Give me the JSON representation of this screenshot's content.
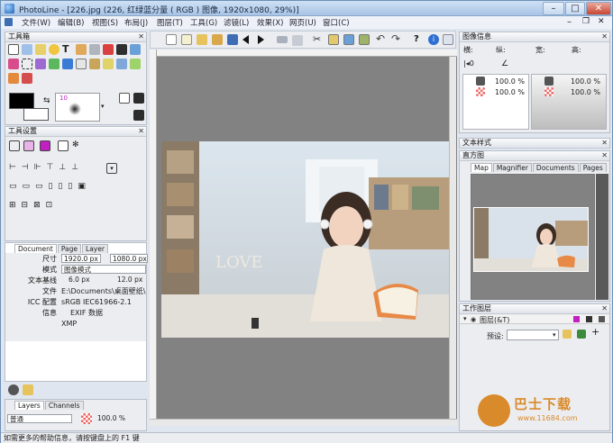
{
  "window": {
    "title": "PhotoLine - [226.jpg (226, 红绿蓝分量 ( RGB ) 图像, 1920x1080, 29%)]"
  },
  "menu": [
    "文件(W)",
    "编辑(B)",
    "视图(S)",
    "布局(J)",
    "图层(T)",
    "工具(G)",
    "滤镜(L)",
    "效果(X)",
    "网页(U)",
    "窗口(C)"
  ],
  "toolbox": {
    "title": "工具箱",
    "brush_size": "10"
  },
  "tool_settings": {
    "title": "工具设置"
  },
  "doc_panel": {
    "tabs": [
      "Document",
      "Page",
      "Layer"
    ],
    "rows": [
      {
        "label": "尺寸",
        "value": "1920.0 px",
        "value2": "1080.0 px"
      },
      {
        "label": "模式",
        "value": "图像模式"
      },
      {
        "label": "文本基线",
        "value": "6.0 px",
        "value2": "12.0 px"
      },
      {
        "label": "文件",
        "value": "E:\\Documents\\桌面壁纸\\"
      },
      {
        "label": "ICC 配置",
        "value": "sRGB IEC61966-2.1"
      },
      {
        "label": "信息",
        "value": "EXIF 数据"
      },
      {
        "label": "",
        "value": "XMP"
      }
    ]
  },
  "layers_panel": {
    "tabs": [
      "Layers",
      "Channels"
    ],
    "mode": "普通",
    "opacity": "100.0 %"
  },
  "image_info": {
    "title": "图像信息",
    "h": "横:",
    "s": "纵:",
    "v": "宽:",
    "r": "高:",
    "val1": "100.0 %",
    "val2": "100.0 %",
    "val3": "100.0 %",
    "val4": "100.0 %"
  },
  "text_style": {
    "title": "文本样式"
  },
  "histogram": {
    "title": "直方图",
    "tabs": [
      "Map",
      "Magnifier",
      "Documents",
      "Pages"
    ]
  },
  "work_layers": {
    "title": "工作图层",
    "layer_name": "图层(&T)",
    "preset_label": "预设:"
  },
  "status": {
    "text": "如需更多的帮助信息，请按键盘上的 F1 键"
  },
  "watermark": {
    "brand": "巴士下载",
    "url": "www.11684.com"
  },
  "colors": {
    "accent": "#d98a2b",
    "panel": "#ecedf0",
    "title": "#a8c4e6",
    "canvas": "#828282"
  }
}
